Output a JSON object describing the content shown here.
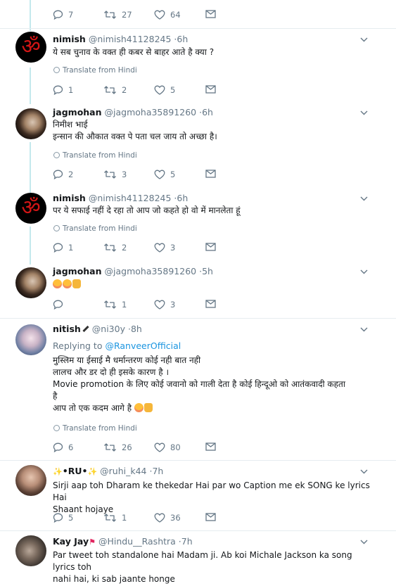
{
  "top_actions": {
    "reply": "7",
    "retweet": "27",
    "like": "64"
  },
  "tweets": [
    {
      "name": "nimish",
      "handle": "@nimish41128245",
      "time": "·6h",
      "lines": [
        "ये सब चुनाव के वक्त ही कबर से बाहर आते है क्या ?"
      ],
      "translate": "Translate from Hindi",
      "reply": "1",
      "retweet": "2",
      "like": "5"
    },
    {
      "name": "jagmohan",
      "handle": "@jagmoha35891260",
      "time": "·6h",
      "lines": [
        "निमीश भाई",
        "इन्सान की औकात वक्त पे पता चल जाय तो अच्छा है।"
      ],
      "translate": "Translate from Hindi",
      "reply": "2",
      "retweet": "3",
      "like": "5"
    },
    {
      "name": "nimish",
      "handle": "@nimish41128245",
      "time": "·6h",
      "lines": [
        "पर ये सफाई नहीं दे रहा तो आप जो कहते हो वो में मानलेता हूं"
      ],
      "translate": "Translate from Hindi",
      "reply": "1",
      "retweet": "2",
      "like": "3"
    },
    {
      "name": "jagmohan",
      "handle": "@jagmoha35891260",
      "time": "·5h",
      "lines": [
        ""
      ],
      "reply": "",
      "retweet": "1",
      "like": "3"
    },
    {
      "name": "nitish",
      "handle": "@ni30y",
      "time": "·8h",
      "replying_prefix": "Replying to ",
      "replying_handle": "@RanveerOfficial",
      "lines": [
        "मुस्लिम या ईसाई मै धर्मान्तरण कोई नही बात नही",
        "लालच और डर दो ही इसके कारण है ।",
        "Movie promotion  के लिए कोई जवानो को गाली देता है कोई हिन्दूओ को आतंकवादी कहता",
        "है",
        "आप तो एक कदम आगे है "
      ],
      "translate": "Translate from Hindi",
      "reply": "6",
      "retweet": "26",
      "like": "80"
    },
    {
      "name": "•RU•",
      "handle": "@ruhi_k44",
      "time": "·7h",
      "lines": [
        "Sirji aap toh Dharam ke thekedar Hai par wo Caption me ek SONG ke lyrics Hai",
        "Shaant hojaye"
      ],
      "reply": "5",
      "retweet": "1",
      "like": "36"
    },
    {
      "name": "Kay Jay",
      "handle": "@Hindu__Rashtra",
      "time": "·7h",
      "lines": [
        "Par tweet toh standalone hai Madam ji. Ab koi Michale Jackson ka song lyrics toh",
        "nahi hai, ki sab jaante honge"
      ]
    }
  ],
  "icons": [
    "reply-icon",
    "retweet-icon",
    "like-icon",
    "message-icon",
    "chevron-down-icon",
    "globe-icon"
  ],
  "colors": {
    "text": "#14171a",
    "muted": "#657786",
    "link": "#1b95e0",
    "thread": "#c4e9ed",
    "divider": "#e6ecf0"
  }
}
